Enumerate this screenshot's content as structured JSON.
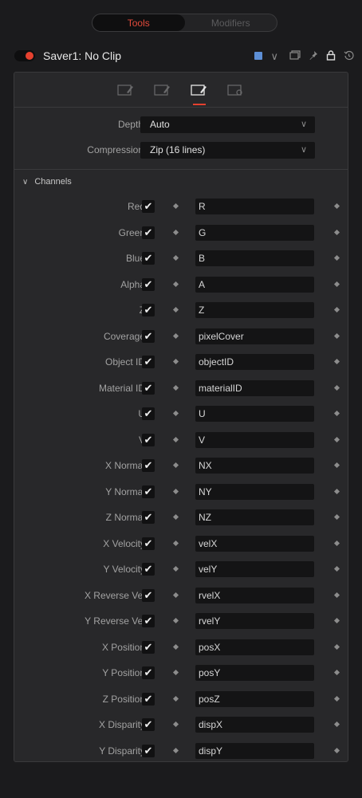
{
  "tabs": {
    "tools": "Tools",
    "modifiers": "Modifiers"
  },
  "header": {
    "title": "Saver1: No Clip",
    "color_chip": "#5d8fd6",
    "chevron": "∨"
  },
  "fields": {
    "depth": {
      "label": "Depth",
      "value": "Auto"
    },
    "compression": {
      "label": "Compression",
      "value": "Zip (16 lines)"
    }
  },
  "section": {
    "title": "Channels"
  },
  "channels": [
    {
      "label": "Red",
      "value": "R"
    },
    {
      "label": "Green",
      "value": "G"
    },
    {
      "label": "Blue",
      "value": "B"
    },
    {
      "label": "Alpha",
      "value": "A"
    },
    {
      "label": "Z",
      "value": "Z"
    },
    {
      "label": "Coverage",
      "value": "pixelCover"
    },
    {
      "label": "Object ID",
      "value": "objectID"
    },
    {
      "label": "Material ID",
      "value": "materialID"
    },
    {
      "label": "U",
      "value": "U"
    },
    {
      "label": "V",
      "value": "V"
    },
    {
      "label": "X Normal",
      "value": "NX"
    },
    {
      "label": "Y Normal",
      "value": "NY"
    },
    {
      "label": "Z Normal",
      "value": "NZ"
    },
    {
      "label": "X Velocity",
      "value": "velX"
    },
    {
      "label": "Y Velocity",
      "value": "velY"
    },
    {
      "label": "X Reverse Vel",
      "value": "rvelX"
    },
    {
      "label": "Y Reverse Vel",
      "value": "rvelY"
    },
    {
      "label": "X Position",
      "value": "posX"
    },
    {
      "label": "Y Position",
      "value": "posY"
    },
    {
      "label": "Z Position",
      "value": "posZ"
    },
    {
      "label": "X Disparity",
      "value": "dispX"
    },
    {
      "label": "Y Disparity",
      "value": "dispY"
    }
  ],
  "check_glyph": "✔",
  "accent": "#e5412f"
}
